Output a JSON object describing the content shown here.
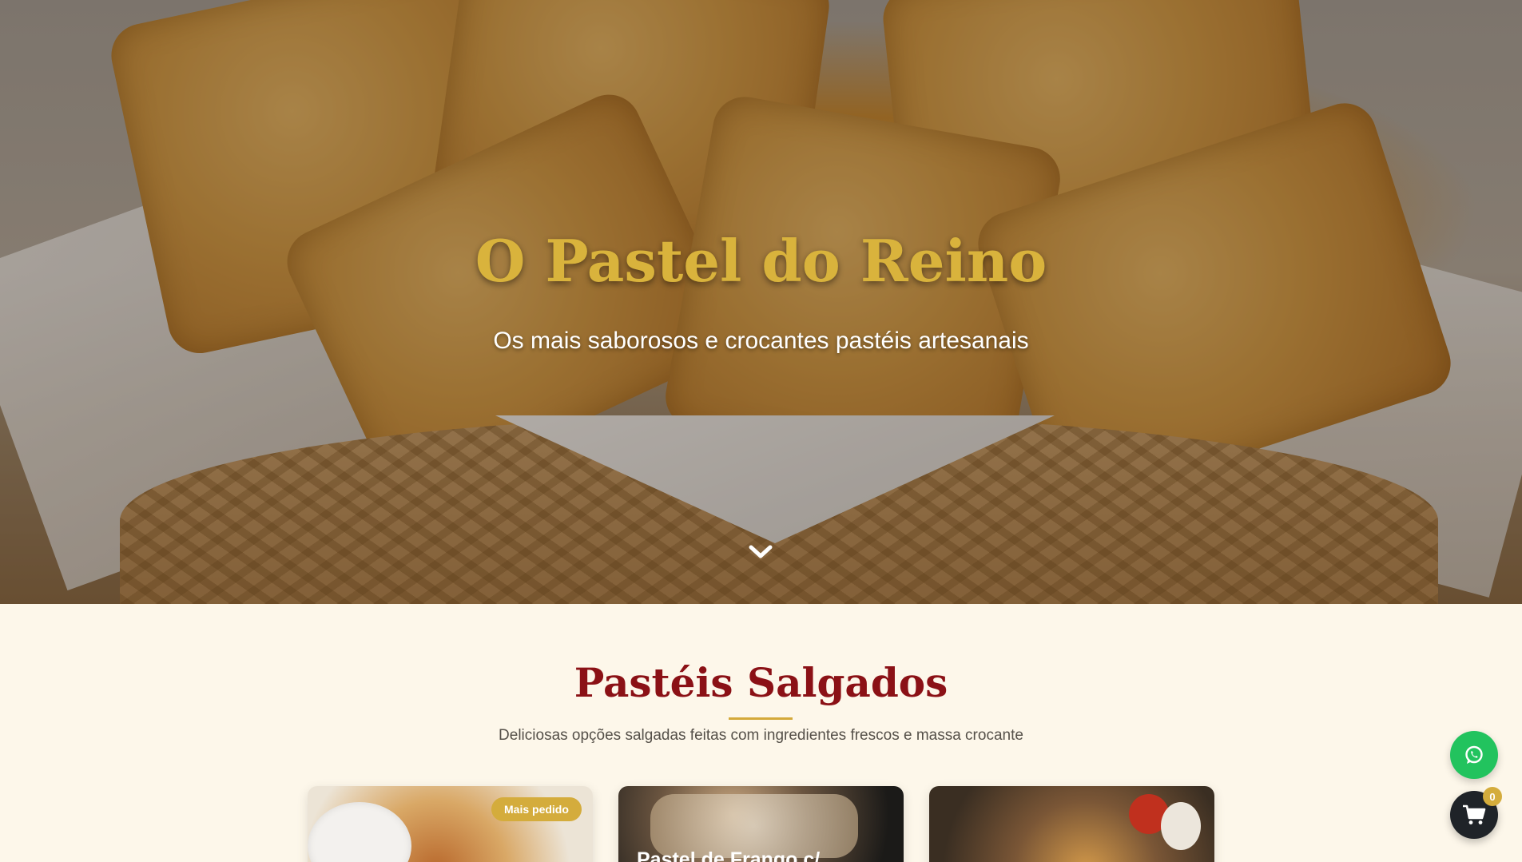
{
  "hero": {
    "title": "O Pastel do Reino",
    "subtitle": "Os mais saborosos e crocantes pastéis artesanais",
    "scroll_icon": "chevron-down-icon"
  },
  "menu_section": {
    "title": "Pastéis Salgados",
    "subtitle": "Deliciosas opções salgadas feitas com ingredientes frescos e massa crocante",
    "cards": [
      {
        "badge": "Mais pedido"
      },
      {
        "title": "Pastel de Frango c/"
      },
      {}
    ]
  },
  "floating": {
    "whatsapp_icon": "whatsapp-icon",
    "cart_icon": "cart-icon",
    "cart_count": "0"
  },
  "colors": {
    "gold": "#d9b33c",
    "accent_red": "#8b1116",
    "background": "#fdf7ea",
    "whatsapp_green": "#22c35e",
    "cart_dark": "#1f2328"
  }
}
